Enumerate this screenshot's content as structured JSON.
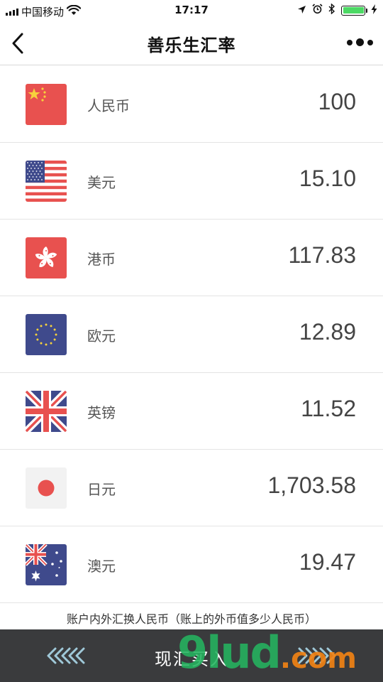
{
  "status_bar": {
    "carrier": "中国移动",
    "time": "17:17"
  },
  "nav": {
    "title": "善乐生汇率",
    "back_icon": "chevron-left-icon",
    "more_icon": "more-dots-icon"
  },
  "currencies": [
    {
      "name": "人民币",
      "value": "100",
      "flag": "cn-flag-icon"
    },
    {
      "name": "美元",
      "value": "15.10",
      "flag": "us-flag-icon"
    },
    {
      "name": "港币",
      "value": "117.83",
      "flag": "hk-flag-icon"
    },
    {
      "name": "欧元",
      "value": "12.89",
      "flag": "eu-flag-icon"
    },
    {
      "name": "英镑",
      "value": "11.52",
      "flag": "uk-flag-icon"
    },
    {
      "name": "日元",
      "value": "1,703.58",
      "flag": "jp-flag-icon"
    },
    {
      "name": "澳元",
      "value": "19.47",
      "flag": "au-flag-icon"
    }
  ],
  "footnote": "账户内外汇换人民币（账上的外币值多少人民币）",
  "bottom_bar": {
    "label": "现汇买入",
    "watermark_main": "9lud",
    "watermark_suffix": ".com"
  },
  "colors": {
    "bottom_bar": "#3a3b3d",
    "arrow": "#9fc8d8",
    "battery": "#4cd964"
  }
}
